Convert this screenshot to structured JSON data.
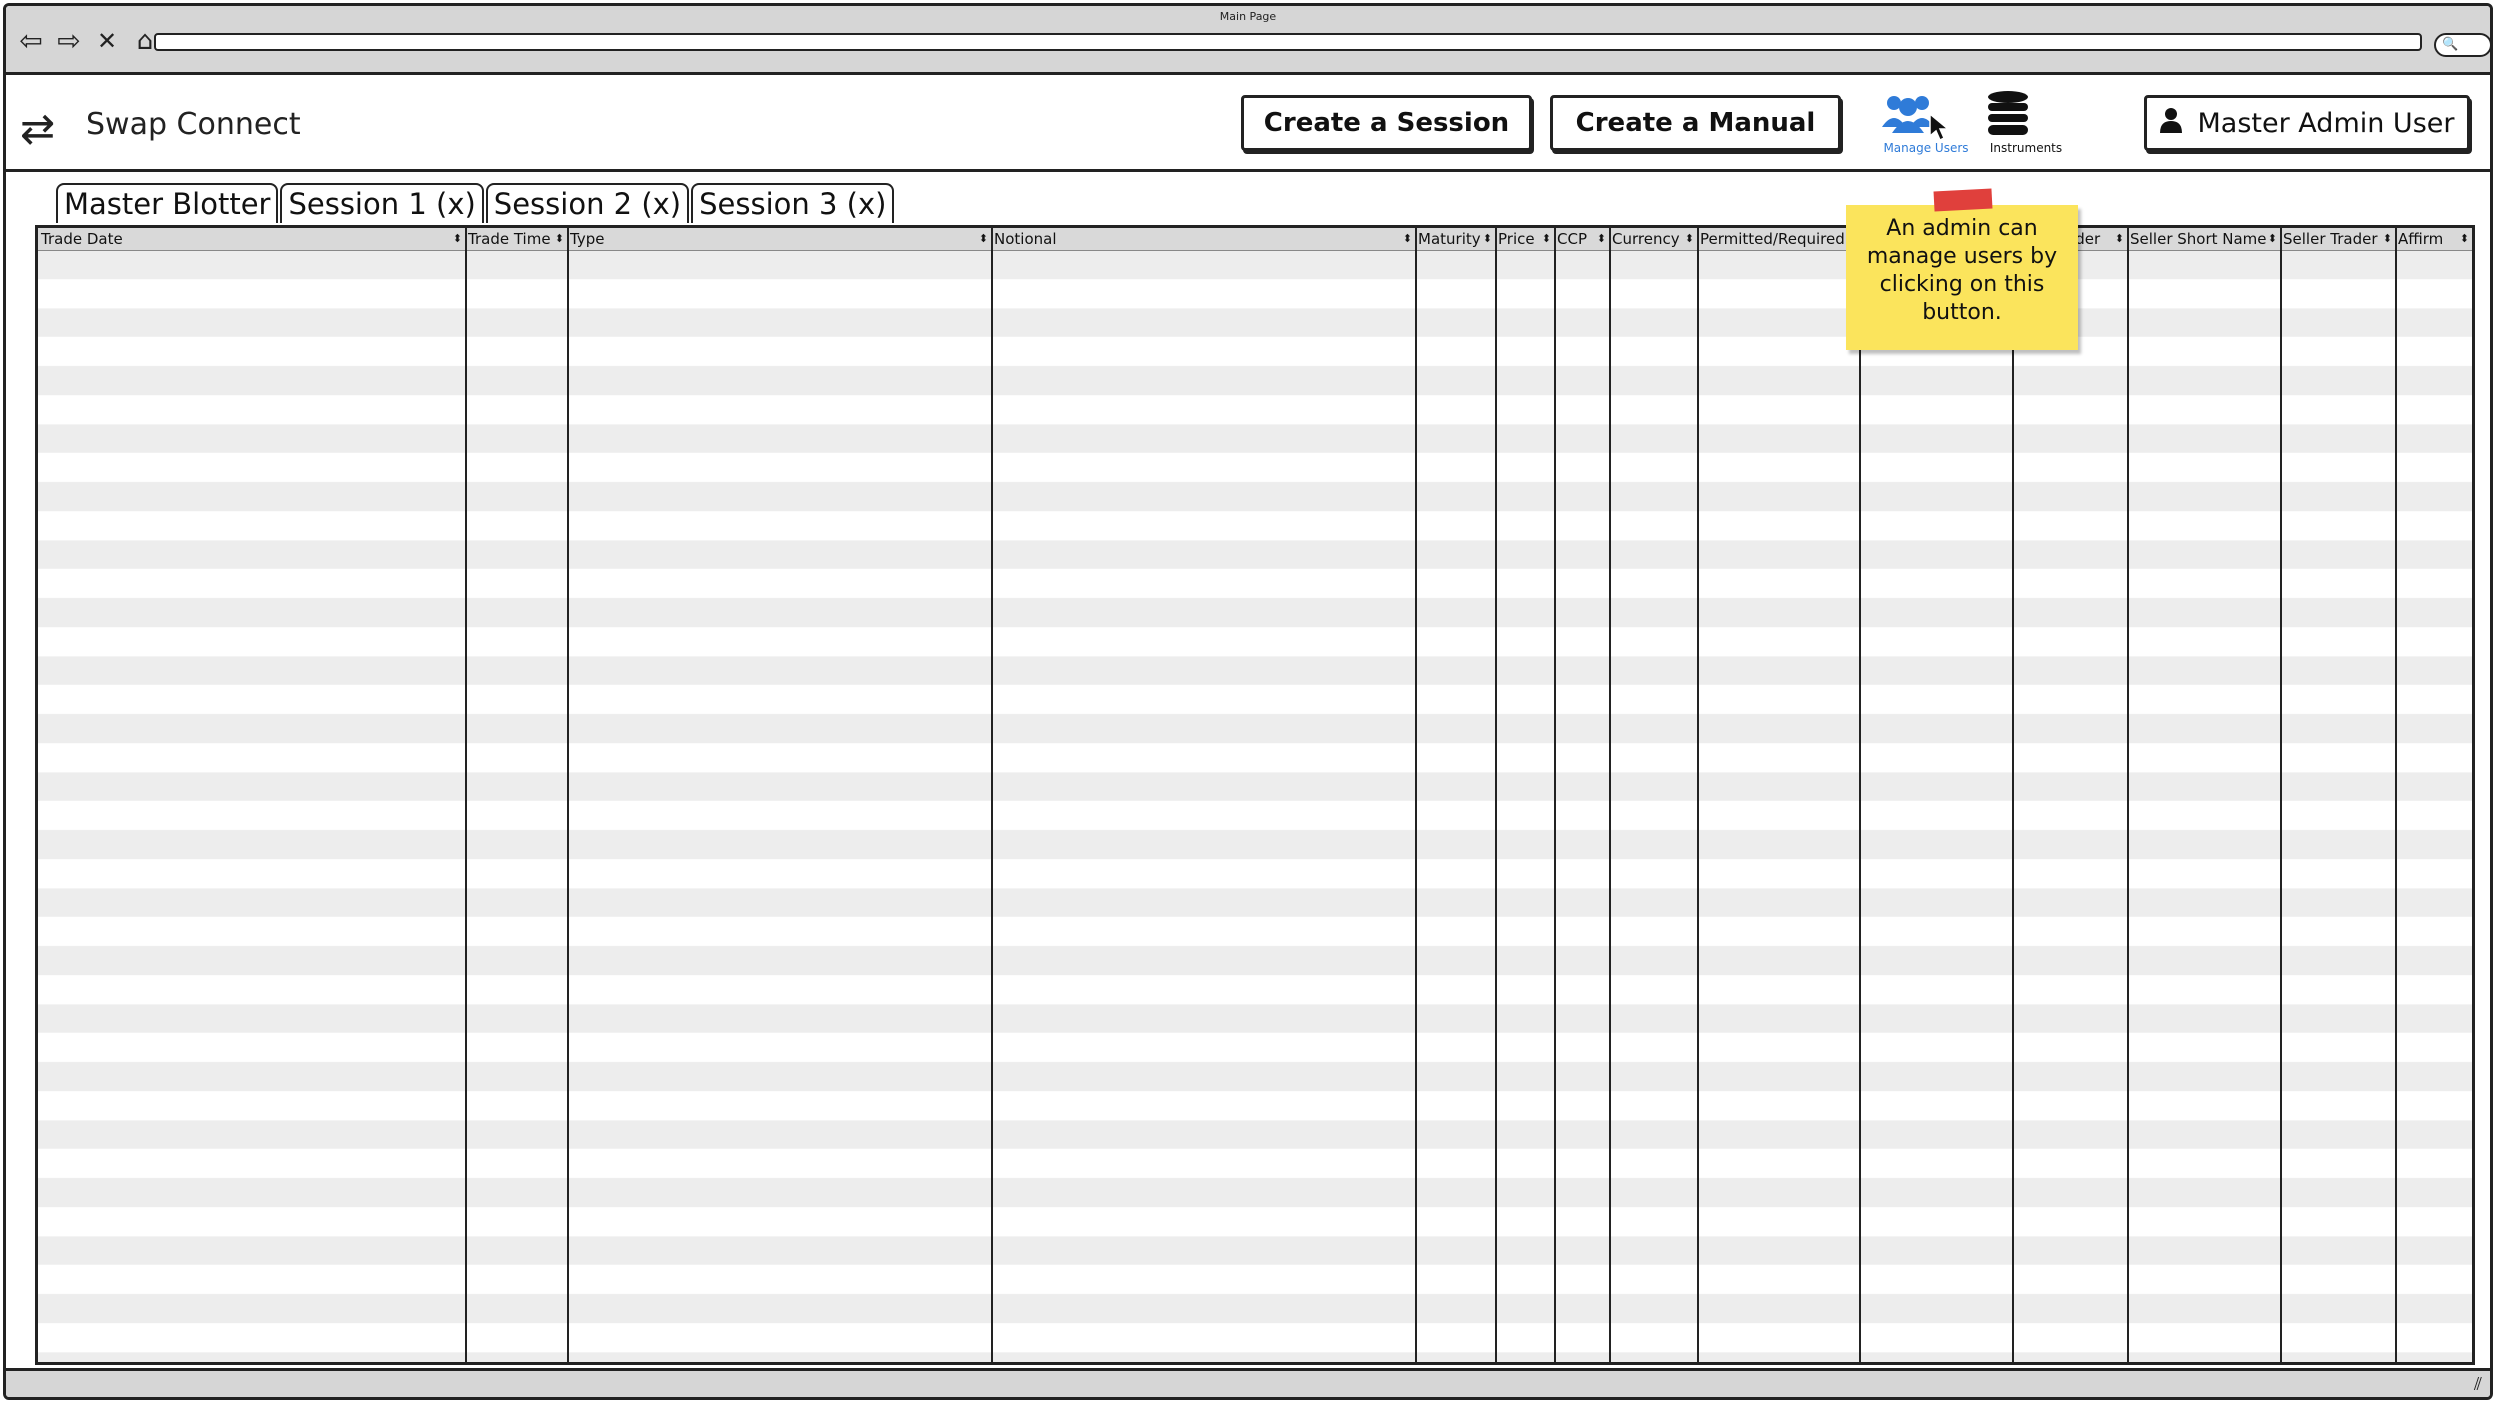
{
  "browser": {
    "page_title": "Main Page",
    "nav_icons": [
      "back-arrow-icon",
      "forward-arrow-icon",
      "close-x-icon",
      "home-icon"
    ],
    "search_glyph": "🔍"
  },
  "app": {
    "name": "Swap Connect",
    "logo_icon": "swap-arrows-icon",
    "buttons": {
      "create_session": "Create a Session",
      "create_manual": "Create a Manual",
      "user": "Master Admin User"
    },
    "icon_buttons": [
      {
        "label": "Manage Users",
        "icon": "users-group-icon",
        "color": "#2f7bd8"
      },
      {
        "label": "Instruments",
        "icon": "database-icon",
        "color": "#111111"
      }
    ]
  },
  "tabs": [
    "Master Blotter",
    "Session 1 (x)",
    "Session 2 (x)",
    "Session 3 (x)"
  ],
  "table": {
    "columns": [
      "Trade Date",
      "Trade Time",
      "Type",
      "Notional",
      "Maturity",
      "Price",
      "CCP",
      "Currency",
      "Permitted/Required",
      "",
      "ader",
      "Seller Short Name",
      "Seller Trader",
      "Affirm"
    ]
  },
  "note": {
    "text": "An admin can manage users by clicking on this button.",
    "color": "#fbe45c",
    "tape_color": "#e0403c"
  }
}
